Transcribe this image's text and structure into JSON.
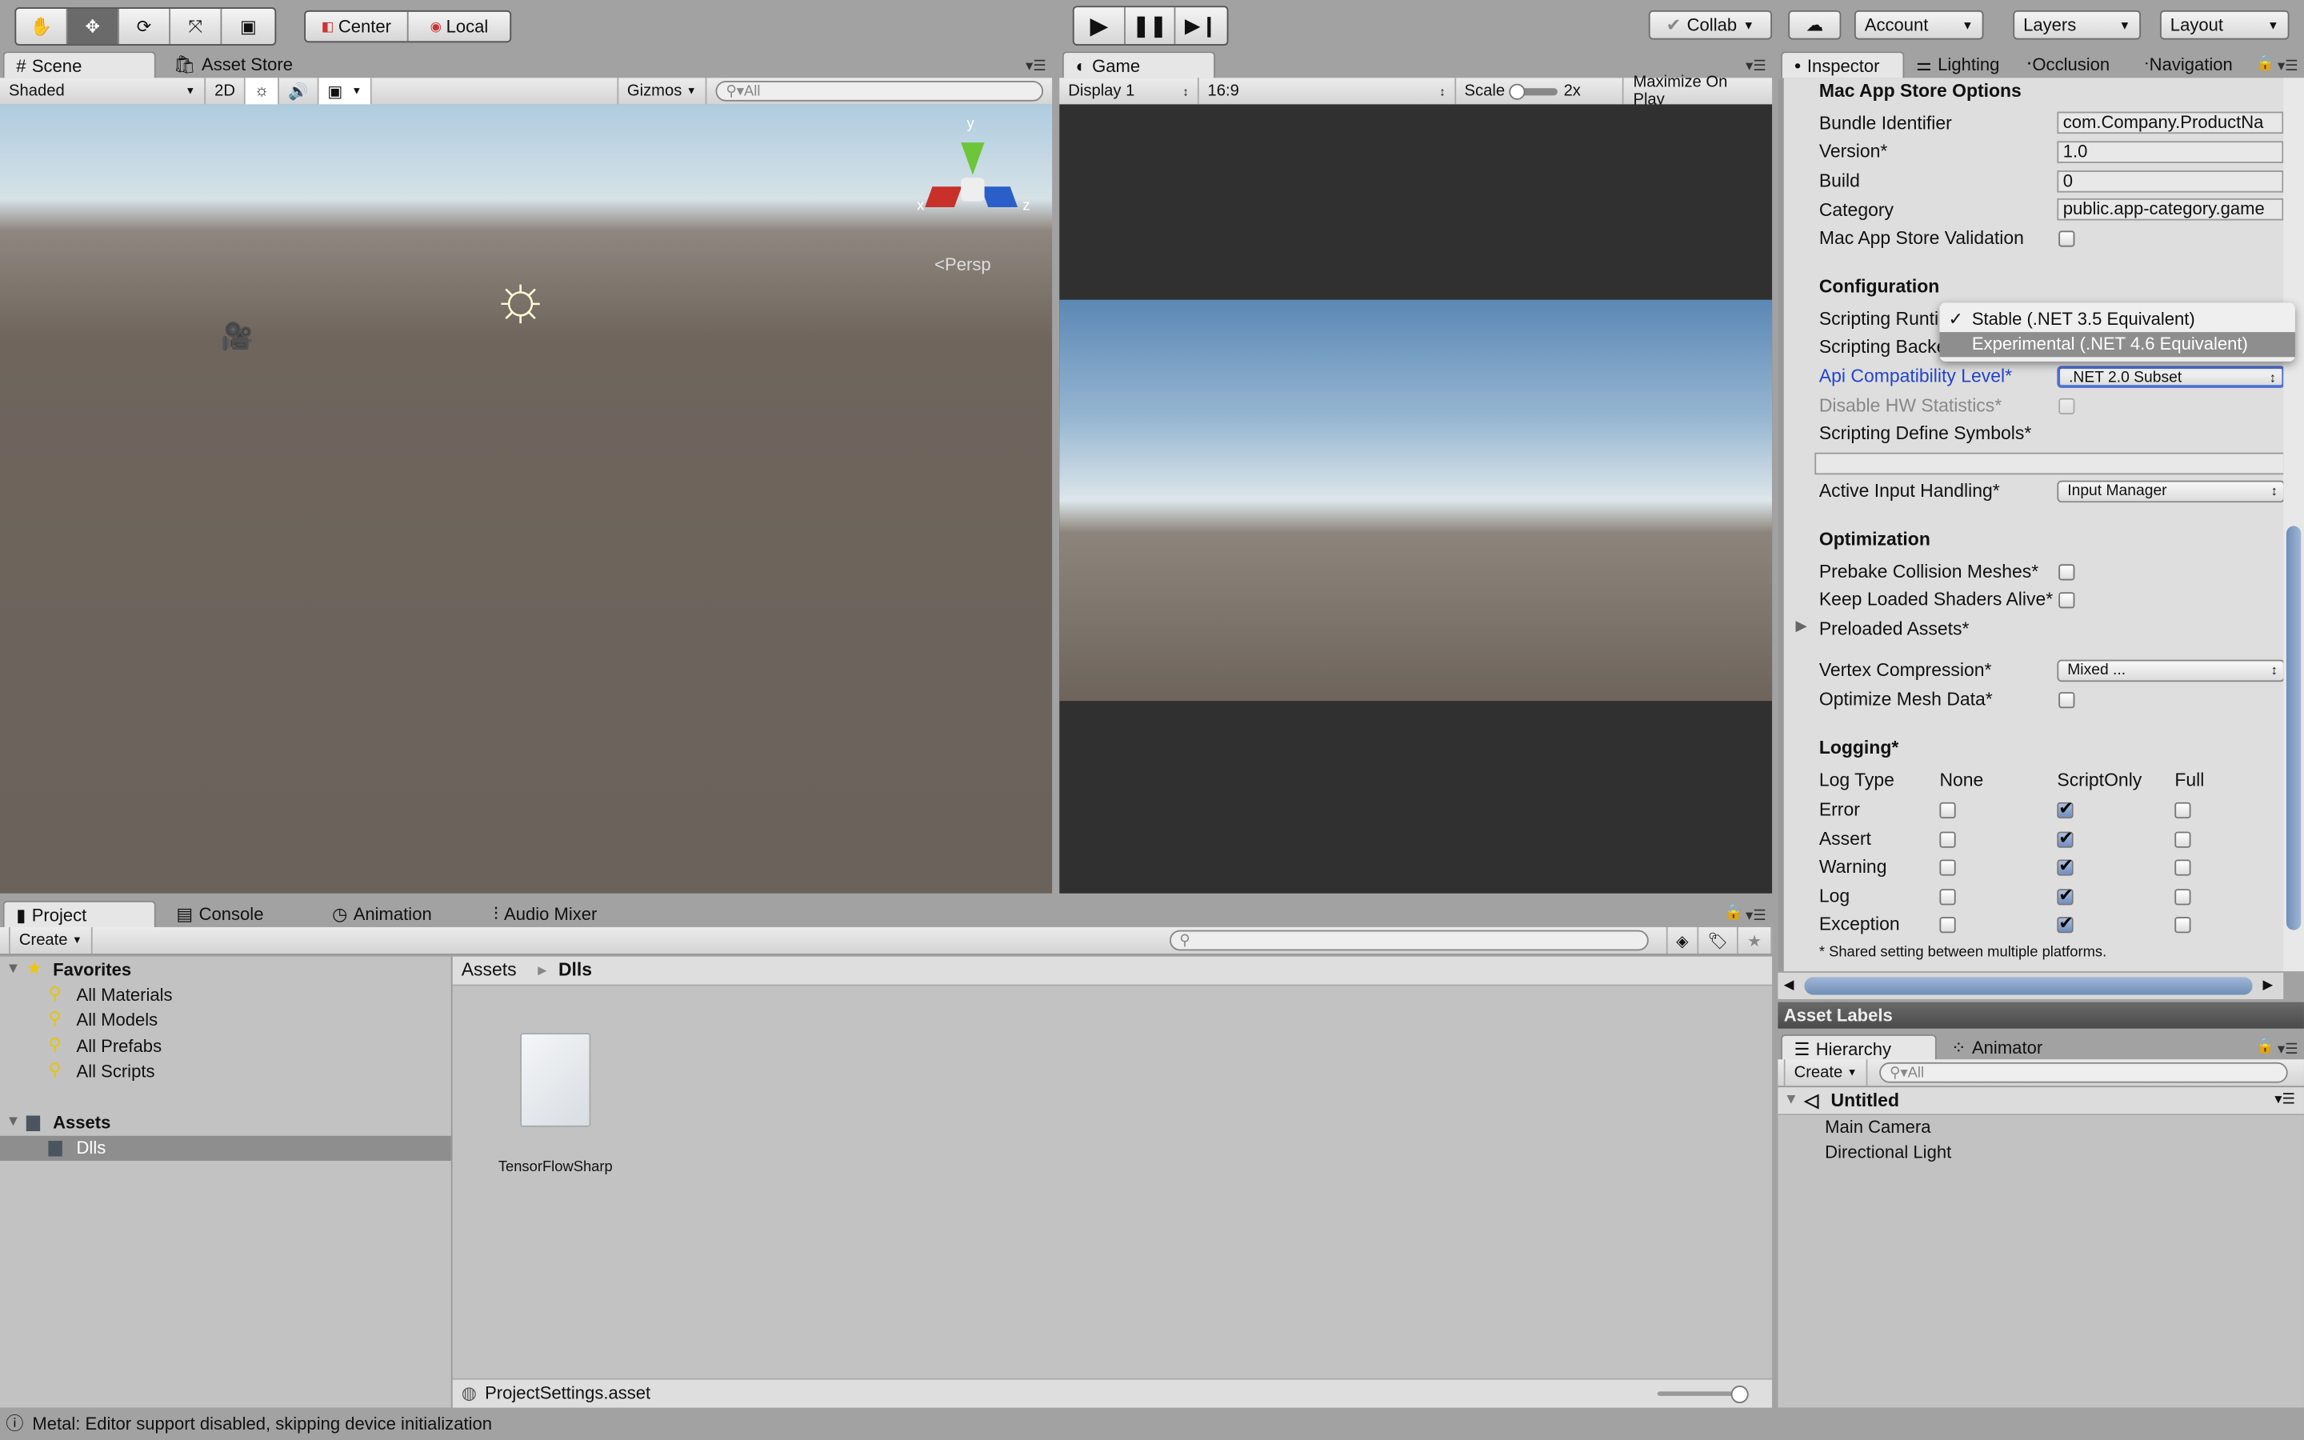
{
  "toolbar": {
    "transform_tools": [
      "hand-tool",
      "move-tool",
      "rotate-tool",
      "scale-tool",
      "rect-tool"
    ],
    "center_label": "Center",
    "local_label": "Local",
    "collab_label": "Collab",
    "account_label": "Account",
    "layers_label": "Layers",
    "layout_label": "Layout"
  },
  "scene": {
    "tabs": [
      "Scene",
      "Asset Store"
    ],
    "shading": "Shaded",
    "mode_2d": "2D",
    "gizmos": "Gizmos",
    "search_placeholder": "All",
    "persp_label": "Persp",
    "axis_labels": {
      "x": "x",
      "y": "y",
      "z": "z"
    }
  },
  "game": {
    "tab": "Game",
    "display": "Display 1",
    "aspect": "16:9",
    "scale_label": "Scale",
    "scale_value": "2x",
    "maximize": "Maximize On Play"
  },
  "inspector": {
    "tabs": [
      "Inspector",
      "Lighting",
      "Occlusion",
      "Navigation"
    ],
    "mac_store_header": "Mac App Store Options",
    "bundle_label": "Bundle Identifier",
    "bundle_value": "com.Company.ProductNa",
    "version_label": "Version*",
    "version_value": "1.0",
    "build_label": "Build",
    "build_value": "0",
    "category_label": "Category",
    "category_value": "public.app-category.game",
    "validation_label": "Mac App Store Validation",
    "config_header": "Configuration",
    "runtime_label": "Scripting Runti",
    "backend_label": "Scripting Backe",
    "api_label": "Api Compatibility Level*",
    "api_value": ".NET 2.0 Subset",
    "hwstats_label": "Disable HW Statistics*",
    "define_label": "Scripting Define Symbols*",
    "define_value": "",
    "input_label": "Active Input Handling*",
    "input_value": "Input Manager",
    "opt_header": "Optimization",
    "prebake_label": "Prebake Collision Meshes*",
    "shaders_label": "Keep Loaded Shaders Alive*",
    "preloaded_label": "Preloaded Assets*",
    "vertex_label": "Vertex Compression*",
    "vertex_value": "Mixed ...",
    "optmesh_label": "Optimize Mesh Data*",
    "logging_header": "Logging*",
    "log_columns": [
      "Log Type",
      "None",
      "ScriptOnly",
      "Full"
    ],
    "log_rows": [
      {
        "name": "Error",
        "value": "ScriptOnly"
      },
      {
        "name": "Assert",
        "value": "ScriptOnly"
      },
      {
        "name": "Warning",
        "value": "ScriptOnly"
      },
      {
        "name": "Log",
        "value": "ScriptOnly"
      },
      {
        "name": "Exception",
        "value": "ScriptOnly"
      }
    ],
    "footnote": "* Shared setting between multiple platforms.",
    "asset_labels": "Asset Labels"
  },
  "runtime_dropdown": {
    "options": [
      "Stable (.NET 3.5 Equivalent)",
      "Experimental (.NET 4.6 Equivalent)"
    ],
    "checked": 0,
    "highlighted": 1
  },
  "hierarchy": {
    "tabs": [
      "Hierarchy",
      "Animator"
    ],
    "create": "Create",
    "search_placeholder": "All",
    "scene_name": "Untitled",
    "items": [
      "Main Camera",
      "Directional Light"
    ]
  },
  "project": {
    "tabs": [
      "Project",
      "Console",
      "Animation",
      "Audio Mixer"
    ],
    "create": "Create",
    "favorites_label": "Favorites",
    "favorites": [
      "All Materials",
      "All Models",
      "All Prefabs",
      "All Scripts"
    ],
    "assets_label": "Assets",
    "folders": [
      "Dlls"
    ],
    "breadcrumb": [
      "Assets",
      "Dlls"
    ],
    "files": [
      "TensorFlowSharp"
    ],
    "footer_file": "ProjectSettings.asset"
  },
  "status": {
    "message": "Metal: Editor support disabled, skipping device initialization"
  },
  "colors": {
    "accent_blue": "#2244cc",
    "highlight": "#8e8e8e",
    "checkbox_on": "#7f9ccb"
  }
}
